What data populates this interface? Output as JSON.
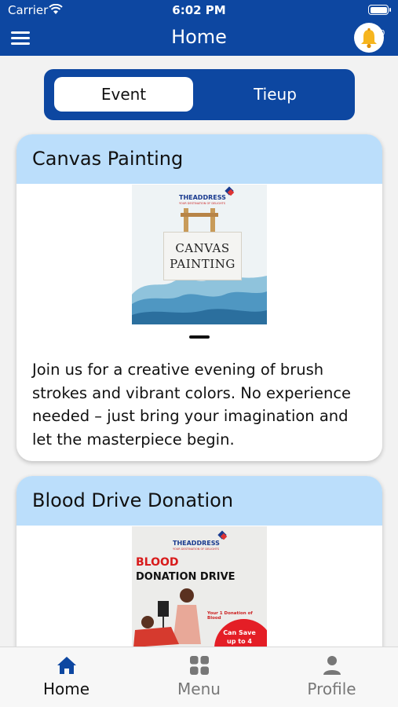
{
  "status_bar": {
    "carrier": "Carrier",
    "time": "6:02 PM",
    "icons": [
      "wifi-icon",
      "battery-icon"
    ]
  },
  "header": {
    "title": "Home",
    "menu_icon": "hamburger-menu-icon",
    "notification_icon": "bell-icon",
    "notification_count": "0",
    "background_color": "#0d47a1"
  },
  "tabs": {
    "items": [
      "Event",
      "Tieup"
    ],
    "selected": "Event"
  },
  "events": [
    {
      "title": "Canvas Painting",
      "poster": {
        "brand": "THEADDRESS",
        "brand_tagline": "YOUR DESTINATION OF DELIGHTS",
        "lines": [
          "CANVAS",
          "PAINTING"
        ]
      },
      "description": "Join us for a creative evening of brush strokes and vibrant colors. No experience needed – just bring your imagination and let the masterpiece begin."
    },
    {
      "title": "Blood Drive Donation",
      "poster": {
        "brand": "THEADDRESS",
        "brand_tagline": "YOUR DESTINATION OF DELIGHTS",
        "headline": "BLOOD",
        "subheadline": "DONATION DRIVE",
        "note": "Your 1 Donation of Blood",
        "badge_lines": [
          "Can Save",
          "up to 4"
        ]
      }
    }
  ],
  "bottom_nav": {
    "items": [
      {
        "label": "Home",
        "icon": "home-icon",
        "active": true
      },
      {
        "label": "Menu",
        "icon": "grid-icon",
        "active": false
      },
      {
        "label": "Profile",
        "icon": "person-icon",
        "active": false
      }
    ]
  },
  "colors": {
    "primary": "#0d47a1",
    "card_header": "#bbdefb",
    "background": "#f2f2f2",
    "inactive_nav": "#777777"
  }
}
